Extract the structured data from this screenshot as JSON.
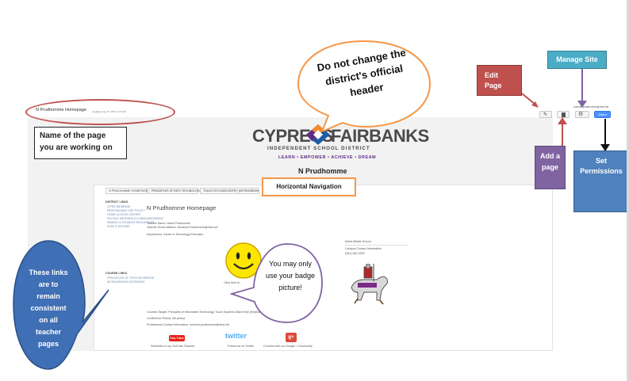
{
  "site": {
    "page_name": "N Prudhomme Homepage",
    "updated": "Updated Aug 25, 2015, 3:37 AM",
    "user_email": "nunimla.prudhomme@cfisd.net",
    "logo_left": "CYPRESS",
    "logo_right": "FAIRBANKS",
    "logo_sub": "INDEPENDENT SCHOOL DISTRICT",
    "tagline": "LEARN • EMPOWER • ACHIEVE • DREAM",
    "site_title": "N Prudhomme",
    "share_label": "Share"
  },
  "nav_tabs": [
    "N PRUDHOMME HOMEPAGE",
    "PRINCIPLES OF INFO TECHNOLOGY",
    "TOUCH SYS DATA ENTRY (KEYBOARDING)"
  ],
  "sidebar": {
    "district_heading": "DISTRICT LINKS",
    "district_links": [
      "CFISD WEBPAGE",
      "RESPONSIBLE USE POLICY",
      "HOME ACCESS CENTER",
      "SCHOOL MATERIALS & ANNOUNCEMENT",
      "PARENT & STUDENT RESOURCES",
      "SAFE & SECURE"
    ],
    "course_heading": "COURSE LINKS",
    "course_links": [
      "PRINCIPLES OF TECH NOTEBOOK",
      "KEYBOARDING NOTEBOOK"
    ]
  },
  "main": {
    "heading": "N Prudhomme Homepage",
    "teacher_name": "Teacher Name: Nisha Prudhomme",
    "teacher_email": "Teacher Email Address: Nunimla.Prudhomme@cfisd.net",
    "department": "Department: Career & Technology Education",
    "badge_caption": "Click here to...",
    "school_name": "Kahla Middle School",
    "campus_info": "Campus Contact Information",
    "campus_phone": "(281) 345-3250",
    "courses": "Courses Taught: Principles of Information Technology, Touch Systems Data Entry (Keyboarding)",
    "conference": "Conference Period: 6th period",
    "contact": "Professional Contact Information: nunimla.prudhomme@cfisd.net",
    "youtube_caption": "Subscribe to my YouTube Channel",
    "twitter_caption": "Follow me on Twitter",
    "google_caption": "Connect with our Google + Community",
    "youtube_logo": "You Tube",
    "twitter_logo": "twitter",
    "google_logo": "g+"
  },
  "callouts": {
    "page_name": "Name of the page you are working on",
    "header": "Do not change the district's official header",
    "edit_page": "Edit Page",
    "manage_site": "Manage Site",
    "add_page": "Add a page",
    "set_permissions": "Set Permissions",
    "horizontal_nav": "Horizontal Navigation",
    "links": "These links are to remain consistent on all teacher pages",
    "badge": "You may only use your badge picture!"
  },
  "colors": {
    "edit_red": "#c0504d",
    "manage_teal": "#4bacc6",
    "add_purple": "#8064a2",
    "perm_blue": "#4f81bd",
    "links_blue": "#3f6fb5",
    "oval_red": "#c0504d",
    "header_orange": "#f79646",
    "nav_orange": "#f79646",
    "badge_purple": "#8064a2",
    "logo_purple": "#5f2a84",
    "logo_orange": "#f28c28",
    "logo_blue": "#1f5aa6"
  }
}
